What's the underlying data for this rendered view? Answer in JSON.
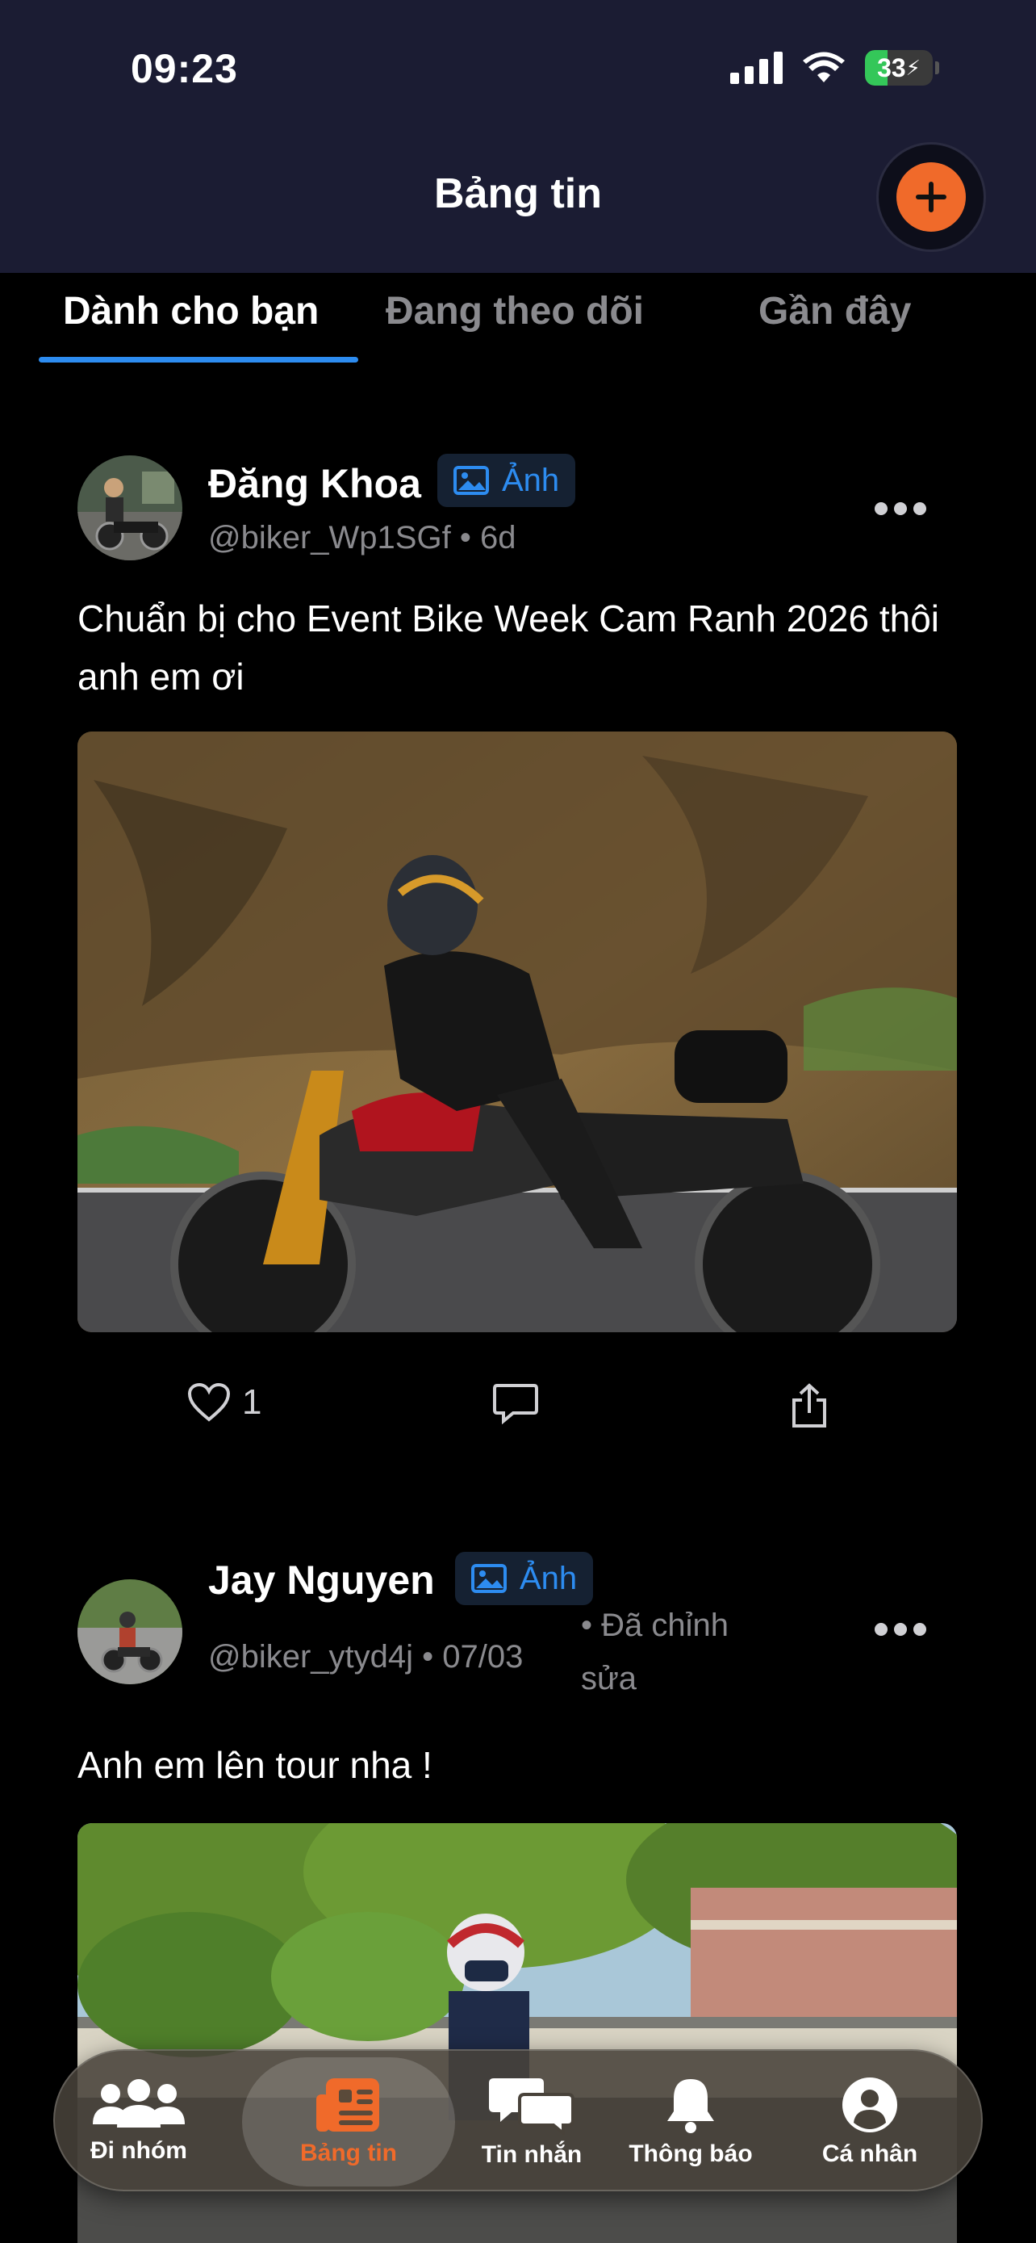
{
  "status_bar": {
    "time": "09:23",
    "battery": "33"
  },
  "header": {
    "title": "Bảng tin"
  },
  "tabs": [
    {
      "label": "Dành cho bạn",
      "active": true
    },
    {
      "label": "Đang theo dõi",
      "active": false
    },
    {
      "label": "Gần đây",
      "active": false
    }
  ],
  "posts": [
    {
      "author": "Đăng Khoa",
      "media_type": "Ảnh",
      "handle": "@biker_Wp1SGf",
      "time": "6d",
      "edited": "",
      "text": "Chuẩn bị cho Event Bike Week Cam Ranh 2026 thôi anh em ơi",
      "likes": "1",
      "image": "motorcycle-rider-photo"
    },
    {
      "author": "Jay Nguyen",
      "media_type": "Ảnh",
      "handle": "@biker_ytyd4j",
      "time": "07/03",
      "edited": "Đã chỉnh sửa",
      "text": "Anh em lên tour nha !",
      "image": "tour-group-photo"
    }
  ],
  "bottom_nav": [
    {
      "label": "Đi nhóm",
      "icon": "group-icon",
      "active": false
    },
    {
      "label": "Bảng tin",
      "icon": "feed-icon",
      "active": true
    },
    {
      "label": "Tin nhắn",
      "icon": "chat-icon",
      "active": false
    },
    {
      "label": "Thông báo",
      "icon": "bell-icon",
      "active": false
    },
    {
      "label": "Cá nhân",
      "icon": "profile-icon",
      "active": false
    }
  ],
  "colors": {
    "accent": "#f06a2a",
    "tab_indicator": "#2d8cf0",
    "header_bg": "#1b1c33"
  }
}
